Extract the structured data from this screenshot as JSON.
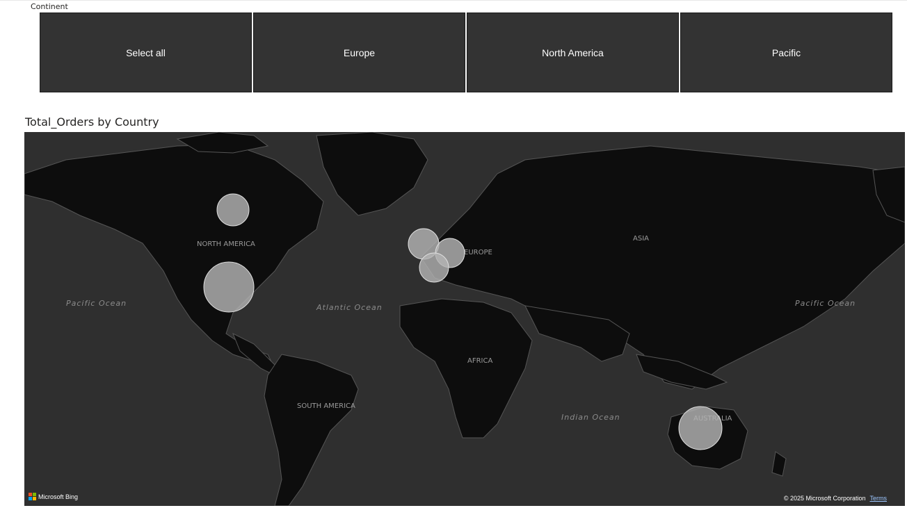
{
  "slicer": {
    "header": "Continent",
    "tiles": [
      {
        "label": "Select all"
      },
      {
        "label": "Europe"
      },
      {
        "label": "North America"
      },
      {
        "label": "Pacific"
      }
    ]
  },
  "map": {
    "title": "Total_Orders by Country",
    "oceans": {
      "pacific_west": "Pacific Ocean",
      "atlantic": "Atlantic Ocean",
      "indian": "Indian Ocean",
      "pacific_east": "Pacific Ocean"
    },
    "continents": {
      "north_america": "NORTH AMERICA",
      "south_america": "SOUTH AMERICA",
      "europe": "EUROPE",
      "africa": "AFRICA",
      "asia": "ASIA",
      "australia": "AUSTRALIA"
    },
    "bubble_color": "#b3b3b3",
    "map_background": "#2f2f2f",
    "land_color": "#0d0d0d",
    "bing_label": "Microsoft Bing",
    "copyright": "© 2025 Microsoft Corporation",
    "terms_label": "Terms"
  }
}
